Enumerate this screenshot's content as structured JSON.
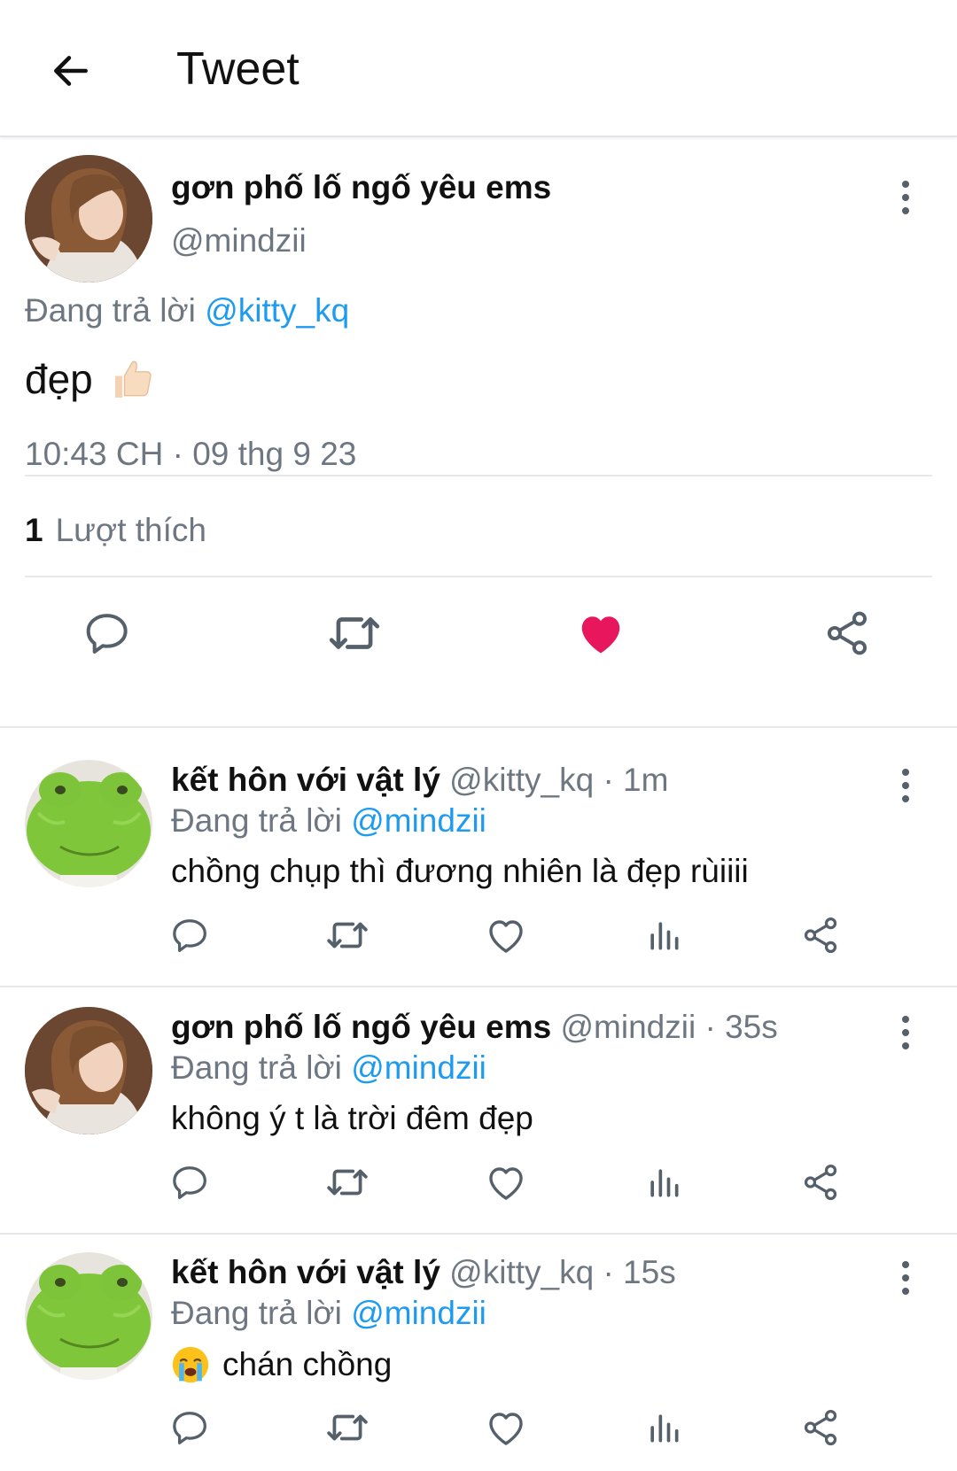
{
  "header": {
    "title": "Tweet",
    "back_icon": "arrow-left-icon"
  },
  "main_tweet": {
    "display_name": "gơn phố lố ngố yêu ems",
    "handle": "@mindzii",
    "reply_prefix": "Đang trả lời",
    "reply_to": "@kitty_kq",
    "text": "đẹp",
    "emoji_icon": "thumbs-up-icon",
    "timestamp": "10:43 CH · 09 thg 9 23",
    "like_count": "1",
    "like_label": "Lượt thích",
    "liked": true,
    "like_color": "#f91880"
  },
  "replies": [
    {
      "display_name": "kết hôn với vật lý",
      "meta": " @kitty_kq · 1m",
      "reply_prefix": "Đang trả lời",
      "reply_to": "@mindzii",
      "text": "chồng chụp thì đương nhiên là đẹp rùiiii"
    },
    {
      "display_name": "gơn phố lố ngố yêu ems",
      "meta": " @mindzii · 35s",
      "reply_prefix": "Đang trả lời",
      "reply_to": "@mindzii",
      "text": "không ý t là trời đêm đẹp"
    },
    {
      "display_name": "kết hôn với vật lý",
      "meta": " @kitty_kq · 15s",
      "reply_prefix": "Đang trả lời",
      "reply_to": "@mindzii",
      "text": "chán chồng",
      "emoji_icon": "crying-face-icon"
    }
  ],
  "colors": {
    "accent": "#1d9bf0",
    "secondary_text": "#6e7781",
    "icon": "#55606b"
  }
}
